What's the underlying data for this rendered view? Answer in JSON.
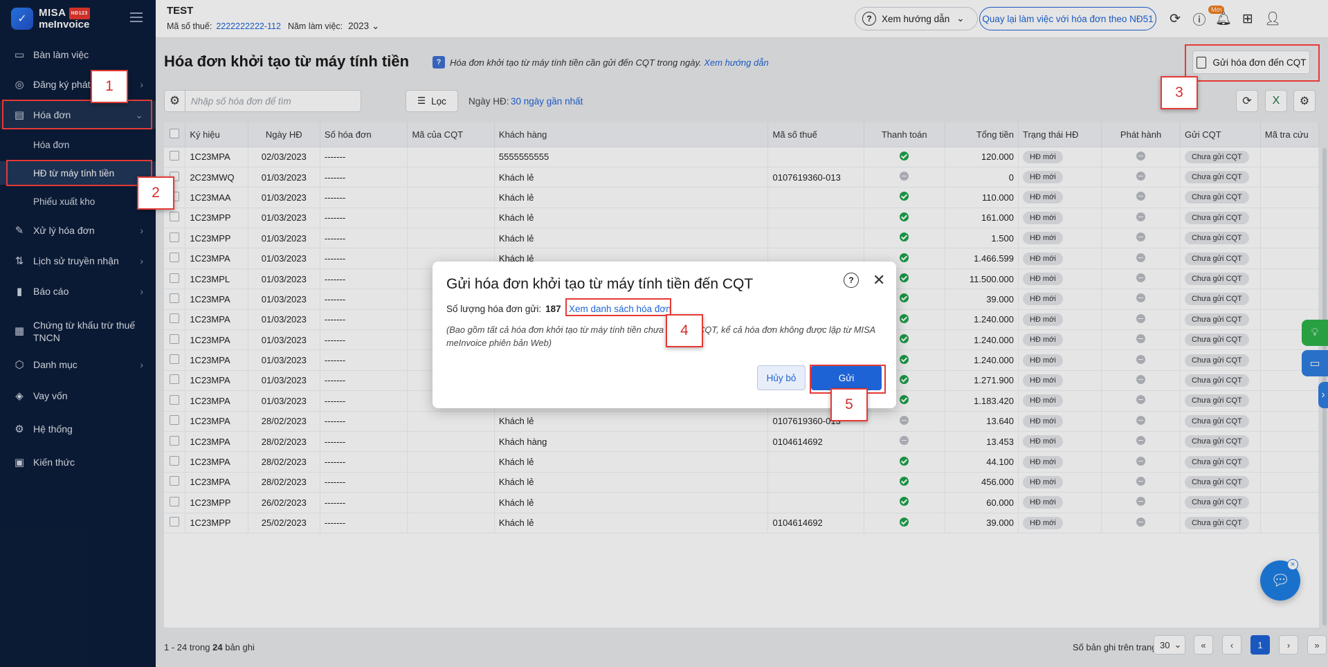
{
  "app": {
    "brand_line1": "MISA",
    "brand_line2": "meInvoice",
    "brand_badge": "NĐ123",
    "company": "TEST",
    "tax_label": "Mã số thuế:",
    "tax_value": "2222222222-112",
    "year_label": "Năm làm việc:",
    "year_value": "2023",
    "guide_label": "Xem hướng dẫn",
    "back_label": "Quay lại làm việc với hóa đơn theo NĐ51",
    "new_badge": "Mới"
  },
  "sidebar": {
    "items": [
      {
        "label": "Bàn làm việc",
        "icon": "monitor-icon"
      },
      {
        "label": "Đăng ký phát hành",
        "icon": "badge-icon"
      },
      {
        "label": "Hóa đơn",
        "icon": "invoice-icon"
      },
      {
        "label": "Xử lý hóa đơn",
        "icon": "edit-doc-icon"
      },
      {
        "label": "Lịch sử truyền nhận",
        "icon": "transfer-icon"
      },
      {
        "label": "Báo cáo",
        "icon": "chart-icon"
      },
      {
        "label": "Chứng từ khấu trừ thuế TNCN",
        "icon": "tax-doc-icon"
      },
      {
        "label": "Danh mục",
        "icon": "box-icon"
      },
      {
        "label": "Vay vốn",
        "icon": "loan-icon"
      },
      {
        "label": "Hệ thống",
        "icon": "gear-icon"
      },
      {
        "label": "Kiến thức",
        "icon": "book-icon"
      }
    ],
    "sub_items": [
      "Hóa đơn",
      "HĐ từ máy tính tiền",
      "Phiếu xuất kho"
    ]
  },
  "page": {
    "title": "Hóa đơn khởi tạo từ máy tính tiền",
    "info_text": "Hóa đơn khởi tạo từ máy tính tiền cần gửi đến CQT trong ngày.",
    "info_link": "Xem hướng dẫn",
    "send_button": "Gửi hóa đơn đến CQT",
    "search_placeholder": "Nhập số hóa đơn để tìm",
    "filter_label": "Lọc",
    "date_label": "Ngày HĐ:",
    "date_value": "30 ngày gần nhất"
  },
  "table": {
    "headers": [
      "Ký hiệu",
      "Ngày HĐ",
      "Số hóa đơn",
      "Mã của CQT",
      "Khách hàng",
      "Mã số thuế",
      "Thanh toán",
      "Tổng tiền",
      "Trạng thái HĐ",
      "Phát hành",
      "Gửi CQT",
      "Mã tra cứu"
    ],
    "rows": [
      {
        "kh": "1C23MPA",
        "date": "02/03/2023",
        "num": "-------",
        "cust": "5555555555",
        "tax": "",
        "paid": true,
        "total": "120.000"
      },
      {
        "kh": "2C23MWQ",
        "date": "01/03/2023",
        "num": "-------",
        "cust": "Khách lẻ",
        "tax": "0107619360-013",
        "paid": false,
        "total": "0"
      },
      {
        "kh": "1C23MAA",
        "date": "01/03/2023",
        "num": "-------",
        "cust": "Khách lẻ",
        "tax": "",
        "paid": true,
        "total": "110.000"
      },
      {
        "kh": "1C23MPP",
        "date": "01/03/2023",
        "num": "-------",
        "cust": "Khách lẻ",
        "tax": "",
        "paid": true,
        "total": "161.000"
      },
      {
        "kh": "1C23MPP",
        "date": "01/03/2023",
        "num": "-------",
        "cust": "Khách lẻ",
        "tax": "",
        "paid": true,
        "total": "1.500"
      },
      {
        "kh": "1C23MPA",
        "date": "01/03/2023",
        "num": "-------",
        "cust": "Khách lẻ",
        "tax": "",
        "paid": true,
        "total": "1.466.599"
      },
      {
        "kh": "1C23MPL",
        "date": "01/03/2023",
        "num": "-------",
        "cust": "Khách lẻ",
        "tax": "",
        "paid": true,
        "total": "11.500.000"
      },
      {
        "kh": "1C23MPA",
        "date": "01/03/2023",
        "num": "-------",
        "cust": "Khách lẻ",
        "tax": "",
        "paid": true,
        "total": "39.000"
      },
      {
        "kh": "1C23MPA",
        "date": "01/03/2023",
        "num": "-------",
        "cust": "Khách lẻ",
        "tax": "",
        "paid": true,
        "total": "1.240.000"
      },
      {
        "kh": "1C23MPA",
        "date": "01/03/2023",
        "num": "-------",
        "cust": "Khách lẻ",
        "tax": "",
        "paid": true,
        "total": "1.240.000"
      },
      {
        "kh": "1C23MPA",
        "date": "01/03/2023",
        "num": "-------",
        "cust": "Khách lẻ",
        "tax": "",
        "paid": true,
        "total": "1.240.000"
      },
      {
        "kh": "1C23MPA",
        "date": "01/03/2023",
        "num": "-------",
        "cust": "Khách lẻ",
        "tax": "",
        "paid": true,
        "total": "1.271.900"
      },
      {
        "kh": "1C23MPA",
        "date": "01/03/2023",
        "num": "-------",
        "cust": "Khách lẻ",
        "tax": "",
        "paid": true,
        "total": "1.183.420"
      },
      {
        "kh": "1C23MPA",
        "date": "28/02/2023",
        "num": "-------",
        "cust": "Khách lẻ",
        "tax": "0107619360-013",
        "paid": false,
        "total": "13.640"
      },
      {
        "kh": "1C23MPA",
        "date": "28/02/2023",
        "num": "-------",
        "cust": "Khách hàng",
        "tax": "0104614692",
        "paid": false,
        "total": "13.453"
      },
      {
        "kh": "1C23MPA",
        "date": "28/02/2023",
        "num": "-------",
        "cust": "Khách lẻ",
        "tax": "",
        "paid": true,
        "total": "44.100"
      },
      {
        "kh": "1C23MPA",
        "date": "28/02/2023",
        "num": "-------",
        "cust": "Khách lẻ",
        "tax": "",
        "paid": true,
        "total": "456.000"
      },
      {
        "kh": "1C23MPP",
        "date": "26/02/2023",
        "num": "-------",
        "cust": "Khách lẻ",
        "tax": "",
        "paid": true,
        "total": "60.000"
      },
      {
        "kh": "1C23MPP",
        "date": "25/02/2023",
        "num": "-------",
        "cust": "Khách lẻ",
        "tax": "0104614692",
        "paid": true,
        "total": "39.000"
      }
    ],
    "status_label": "HĐ mới",
    "cqt_label": "Chưa gửi CQT"
  },
  "footer": {
    "range_text": "1 - 24 trong",
    "total": "24",
    "suffix": "bản ghi",
    "per_page_label": "Số bản ghi trên trang",
    "per_page_value": "30",
    "current_page": "1"
  },
  "modal": {
    "title": "Gửi hóa đơn khởi tạo từ máy tính tiền đến CQT",
    "count_label": "Số lượng hóa đơn gửi:",
    "count_value": "187",
    "list_link": "Xem danh sách hóa đơn",
    "note": "(Bao gồm tất cả hóa đơn khởi tạo từ máy tính tiền chưa gửi đến CQT, kể cả hóa đơn không được lập từ MISA meInvoice phiên bản Web)",
    "cancel": "Hủy bỏ",
    "send": "Gửi"
  },
  "annotations": [
    "1",
    "2",
    "3",
    "4",
    "5"
  ],
  "colors": {
    "sidebar": "#0d1e3a",
    "accent": "#1e63d6",
    "annotation": "#e53935",
    "paid": "#1aa34a"
  }
}
